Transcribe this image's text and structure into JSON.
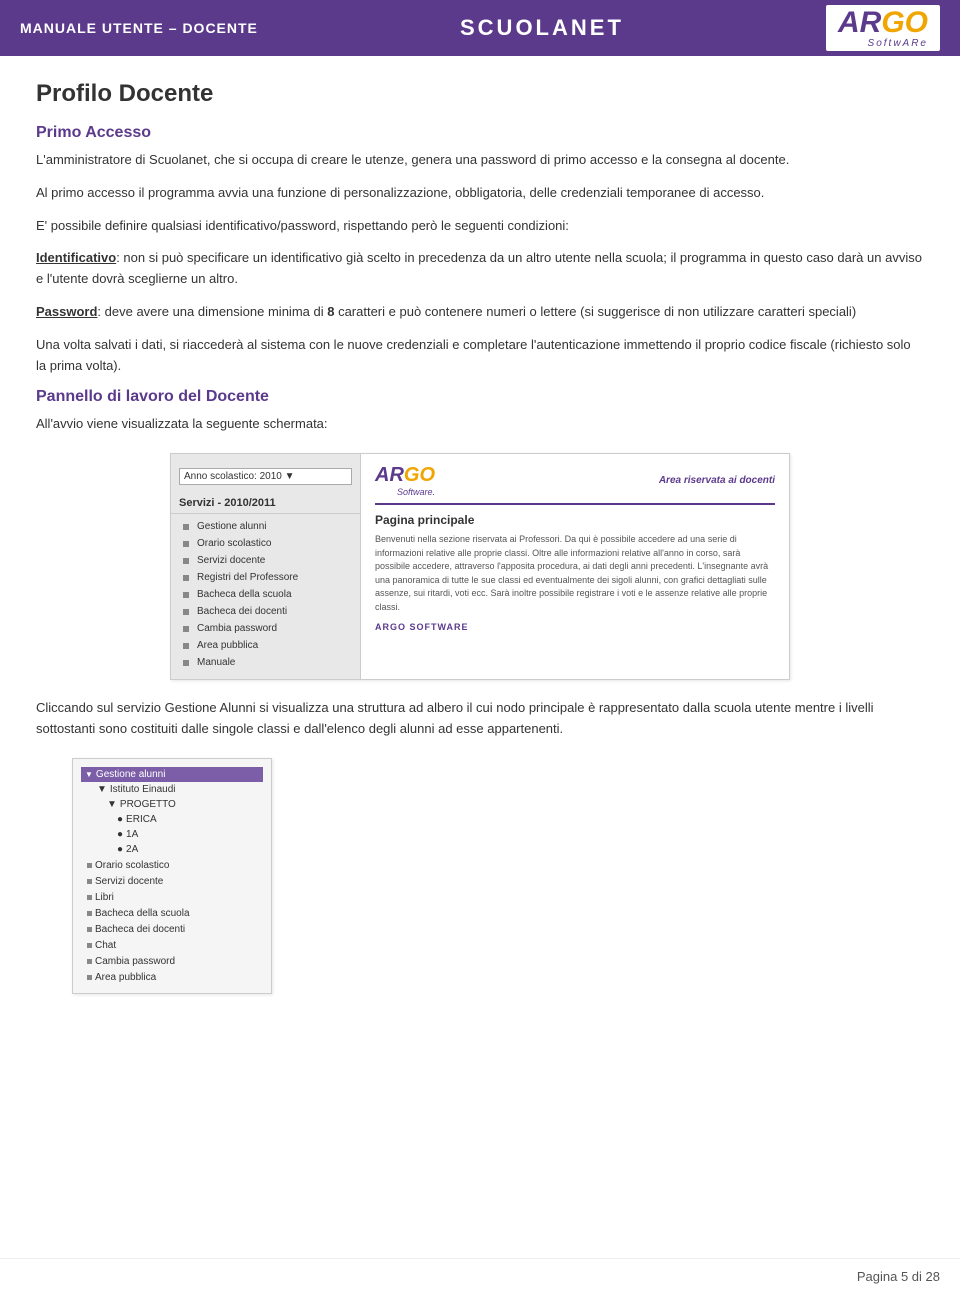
{
  "header": {
    "left_text": "MANUALE UTENTE – DOCENTE",
    "center_text": "SCUOLANET",
    "logo_ar": "AR",
    "logo_go": "GO",
    "logo_software": "SoftwARe"
  },
  "page": {
    "title": "Profilo Docente",
    "sections": [
      {
        "id": "primo_accesso",
        "title": "Primo Accesso",
        "paragraphs": [
          "L'amministratore di Scuolanet, che si occupa di creare le utenze, genera una password di primo accesso e la consegna al docente.",
          "Al primo accesso il programma avvia una funzione di personalizzazione, obbligatoria, delle credenziali temporanee di accesso.",
          "E' possibile definire qualsiasi identificativo/password, rispettando però le seguenti condizioni:",
          "Identificativo: non si può specificare un identificativo già scelto in precedenza da un altro utente nella scuola; il programma in questo caso darà un avviso e l'utente dovrà sceglierne un altro.",
          "Password: deve avere una dimensione minima di 8 caratteri e può contenere numeri o lettere (si suggerisce di non utilizzare caratteri speciali)",
          "Una volta salvati i dati,  si riaccederà  al sistema con le nuove credenziali e completare l'autenticazione immettendo il proprio codice fiscale (richiesto solo la prima volta)."
        ]
      },
      {
        "id": "pannello_lavoro",
        "title": "Pannello di lavoro del Docente",
        "paragraphs": [
          "All'avvio viene visualizzata la seguente schermata:"
        ]
      },
      {
        "id": "after_screenshot",
        "paragraphs": [
          "Cliccando sul servizio Gestione Alunni si visualizza una struttura ad albero il cui nodo principale è rappresentato dalla scuola utente mentre i livelli sottostanti sono costituiti dalle singole classi e dall'elenco degli alunni ad esse appartenenti."
        ]
      }
    ],
    "screenshot1": {
      "year_label": "Anno scolastico: 2010",
      "services_title": "Servizi - 2010/2011",
      "menu_items": [
        "Gestione alunni",
        "Orario scolastico",
        "Servizi docente",
        "Registri del Professore",
        "Bacheca della scuola",
        "Bacheca dei docenti",
        "Cambia password",
        "Area pubblica",
        "Manuale"
      ],
      "right_panel": {
        "area_label": "Area riservata ai docenti",
        "page_title": "Pagina principale",
        "body_text": "Benvenuti nella sezione riservata ai Professori. Da qui è possibile accedere ad una serie di informazioni relative alle proprie classi. Oltre alle informazioni relative all'anno in corso, sarà possibile accedere, attraverso l'apposita procedura, ai dati degli anni precedenti. L'insegnante avrà  una panoramica di tutte le sue classi ed eventualmente dei sigoli alunni, con grafici dettagliati sulle assenze, sui ritardi, voti ecc. Sarà  inoltre possibile registrare i voti e le assenze relative alle proprie classi.",
        "footer": "ARGO SOFTWARE"
      }
    },
    "screenshot2": {
      "tree": [
        {
          "label": "Gestione alunni",
          "level": 0,
          "active": true
        },
        {
          "label": "Istituto Einaudi",
          "level": 1,
          "active": false
        },
        {
          "label": "PROGETTO",
          "level": 2,
          "active": false
        },
        {
          "label": "ERICA",
          "level": 3,
          "active": false
        },
        {
          "label": "1A",
          "level": 3,
          "active": false
        },
        {
          "label": "2A",
          "level": 3,
          "active": false
        }
      ],
      "menu_items": [
        "Orario scolastico",
        "Servizi docente",
        "Libri",
        "Bacheca della scuola",
        "Bacheca dei docenti",
        "Chat",
        "Cambia password",
        "Area pubblica"
      ]
    }
  },
  "footer": {
    "text": "Pagina 5 di 28"
  }
}
